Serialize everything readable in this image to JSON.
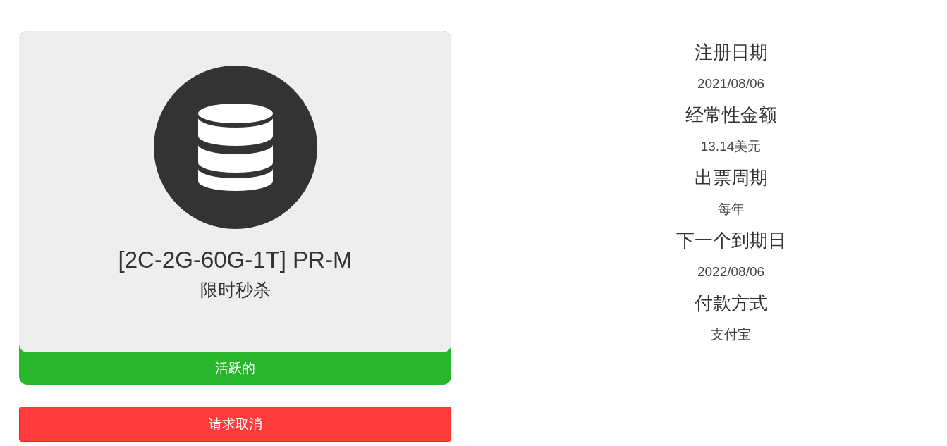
{
  "product": {
    "title": "[2C-2G-60G-1T] PR-M",
    "subtitle": "限时秒杀",
    "status": "活跃的"
  },
  "details": [
    {
      "label": "注册日期",
      "value": "2021/08/06"
    },
    {
      "label": "经常性金额",
      "value": "13.14美元"
    },
    {
      "label": "出票周期",
      "value": "每年"
    },
    {
      "label": "下一个到期日",
      "value": "2022/08/06"
    },
    {
      "label": "付款方式",
      "value": "支付宝"
    }
  ],
  "cancel_button": "请求取消"
}
